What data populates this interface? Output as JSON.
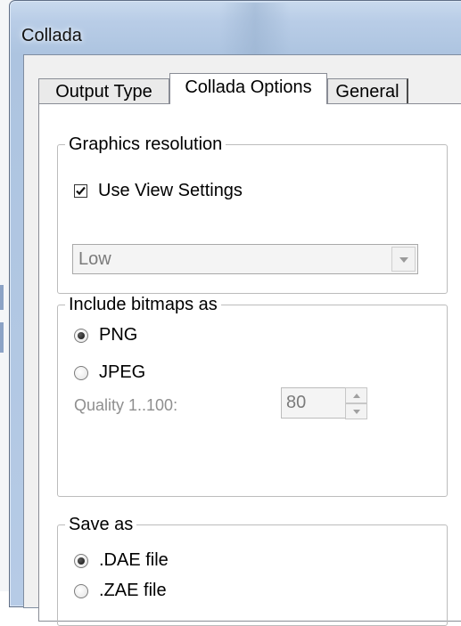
{
  "window": {
    "title": "Collada"
  },
  "tabs": [
    {
      "label": "Output Type",
      "active": false
    },
    {
      "label": "Collada Options",
      "active": true
    },
    {
      "label": "General",
      "active": false
    }
  ],
  "graphics_resolution": {
    "legend": "Graphics resolution",
    "use_view_settings": {
      "label": "Use View Settings",
      "checked": true
    },
    "resolution_select": {
      "value": "Low",
      "enabled": false
    }
  },
  "include_bitmaps": {
    "legend": "Include bitmaps as",
    "options": [
      {
        "label": "PNG",
        "selected": true
      },
      {
        "label": "JPEG",
        "selected": false
      }
    ],
    "quality": {
      "label": "Quality 1..100:",
      "value": "80",
      "enabled": false
    }
  },
  "save_as": {
    "legend": "Save as",
    "options": [
      {
        "label": ".DAE file",
        "selected": true
      },
      {
        "label": ".ZAE file",
        "selected": false
      }
    ]
  },
  "icons": [
    "checkmark-icon",
    "dropdown-arrow-icon",
    "spin-up-icon",
    "spin-down-icon"
  ]
}
